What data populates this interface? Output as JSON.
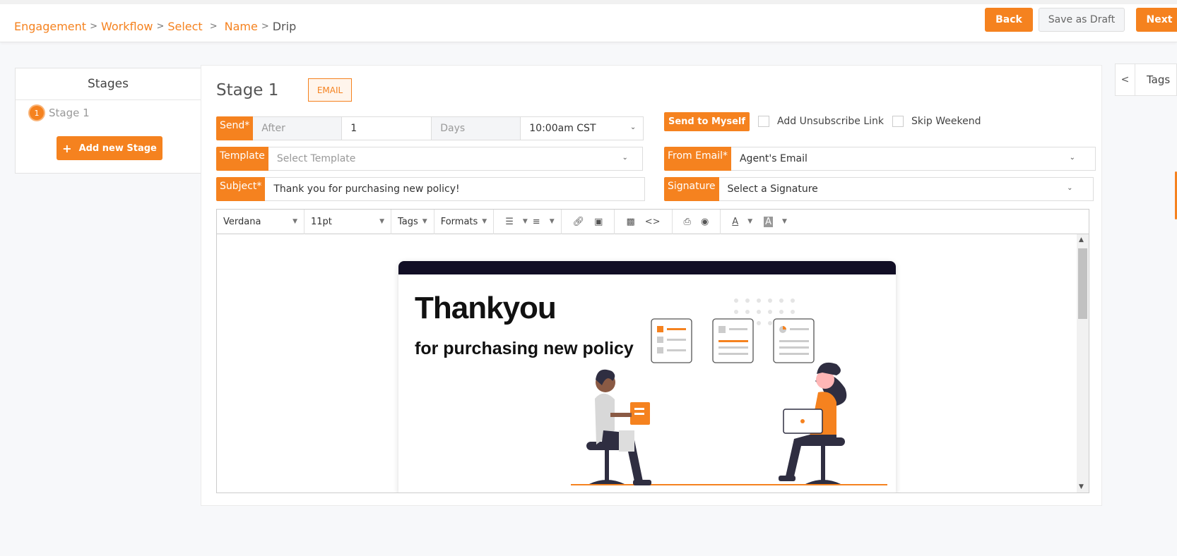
{
  "breadcrumb": [
    "Engagement",
    "Workflow",
    "Select",
    "Name",
    "Drip"
  ],
  "header": {
    "back": "Back",
    "save_draft": "Save as Draft",
    "next": "Next"
  },
  "stages": {
    "title": "Stages",
    "items": [
      {
        "num": "1",
        "label": "Stage 1"
      }
    ],
    "add_button": "Add new Stage"
  },
  "stage": {
    "title": "Stage 1",
    "channel": "EMAIL"
  },
  "send": {
    "label": "Send*",
    "when": "After",
    "amount": "1",
    "unit": "Days",
    "time": "10:00am CST"
  },
  "template": {
    "label": "Template",
    "placeholder": "Select Template"
  },
  "subject": {
    "label": "Subject*",
    "value": "Thank you for purchasing new policy!"
  },
  "options": {
    "send_to_myself": "Send to Myself",
    "unsubscribe": "Add Unsubscribe Link",
    "skip_weekend": "Skip Weekend"
  },
  "from_email": {
    "label": "From Email*",
    "value": "Agent's Email"
  },
  "signature": {
    "label": "Signature",
    "value": "Select a Signature"
  },
  "editor": {
    "font": "Verdana",
    "size": "11pt",
    "tags": "Tags",
    "formats": "Formats"
  },
  "email_body": {
    "headline": "Thankyou",
    "subline": "for purchasing new policy"
  },
  "tags_panel": {
    "label": "Tags"
  },
  "colors": {
    "accent": "#f5821f",
    "dark_band": "#110e25"
  }
}
